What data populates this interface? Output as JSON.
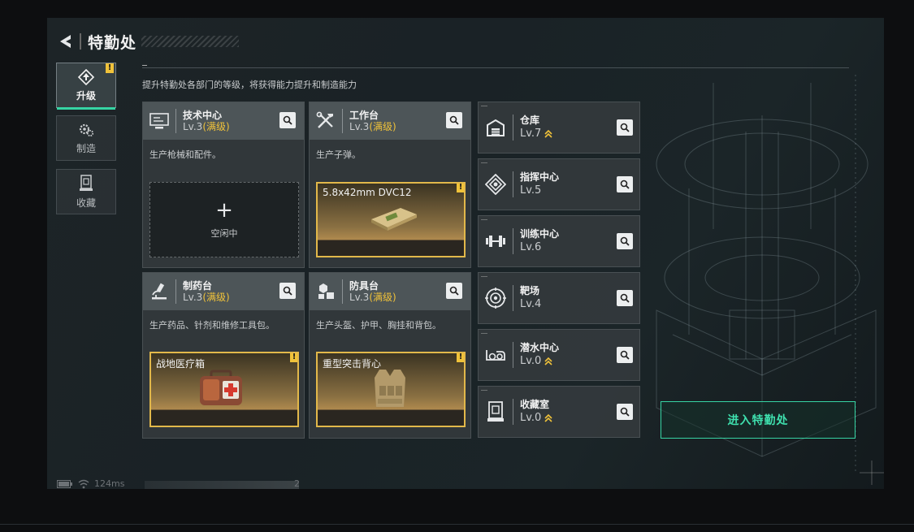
{
  "header": {
    "title": "特勤处"
  },
  "subtitle": "提升特勤处各部门的等级，将获得能力提升和制造能力",
  "nav": [
    {
      "label": "升级",
      "icon": "upgrade-icon",
      "active": true,
      "alert": "!"
    },
    {
      "label": "制造",
      "icon": "gears-icon",
      "active": false
    },
    {
      "label": "收藏",
      "icon": "collection-icon",
      "active": false
    }
  ],
  "workshops": [
    {
      "name": "技术中心",
      "level": "Lv.3",
      "max": "(满级)",
      "icon": "monitor-icon",
      "desc": "生产枪械和配件。",
      "slot": {
        "type": "idle",
        "plus": "+",
        "label": "空闲中"
      }
    },
    {
      "name": "工作台",
      "level": "Lv.3",
      "max": "(满级)",
      "icon": "tools-icon",
      "desc": "生产子弹。",
      "slot": {
        "type": "item",
        "name": "5.8x42mm DVC12",
        "alert": "!"
      }
    },
    {
      "name": "制药台",
      "level": "Lv.3",
      "max": "(满级)",
      "icon": "microscope-icon",
      "desc": "生产药品、针剂和维修工具包。",
      "slot": {
        "type": "item",
        "name": "战地医疗箱",
        "alert": "!"
      }
    },
    {
      "name": "防具台",
      "level": "Lv.3",
      "max": "(满级)",
      "icon": "armor-parts-icon",
      "desc": "生产头盔、护甲、胸挂和背包。",
      "slot": {
        "type": "item",
        "name": "重型突击背心",
        "alert": "!"
      }
    }
  ],
  "facilities": [
    {
      "name": "仓库",
      "level": "Lv.7",
      "upgradable": true,
      "icon": "warehouse-icon"
    },
    {
      "name": "指挥中心",
      "level": "Lv.5",
      "upgradable": false,
      "icon": "command-icon"
    },
    {
      "name": "训练中心",
      "level": "Lv.6",
      "upgradable": false,
      "icon": "dumbbell-icon"
    },
    {
      "name": "靶场",
      "level": "Lv.4",
      "upgradable": false,
      "icon": "target-icon"
    },
    {
      "name": "潜水中心",
      "level": "Lv.0",
      "upgradable": true,
      "icon": "dive-mask-icon"
    },
    {
      "name": "收藏室",
      "level": "Lv.0",
      "upgradable": true,
      "icon": "showcase-icon"
    }
  ],
  "enter_button": "进入特勤处",
  "status": {
    "ping": "124ms",
    "num": "2"
  },
  "colors": {
    "accent": "#36d4a4",
    "gold": "#f0c23a"
  }
}
